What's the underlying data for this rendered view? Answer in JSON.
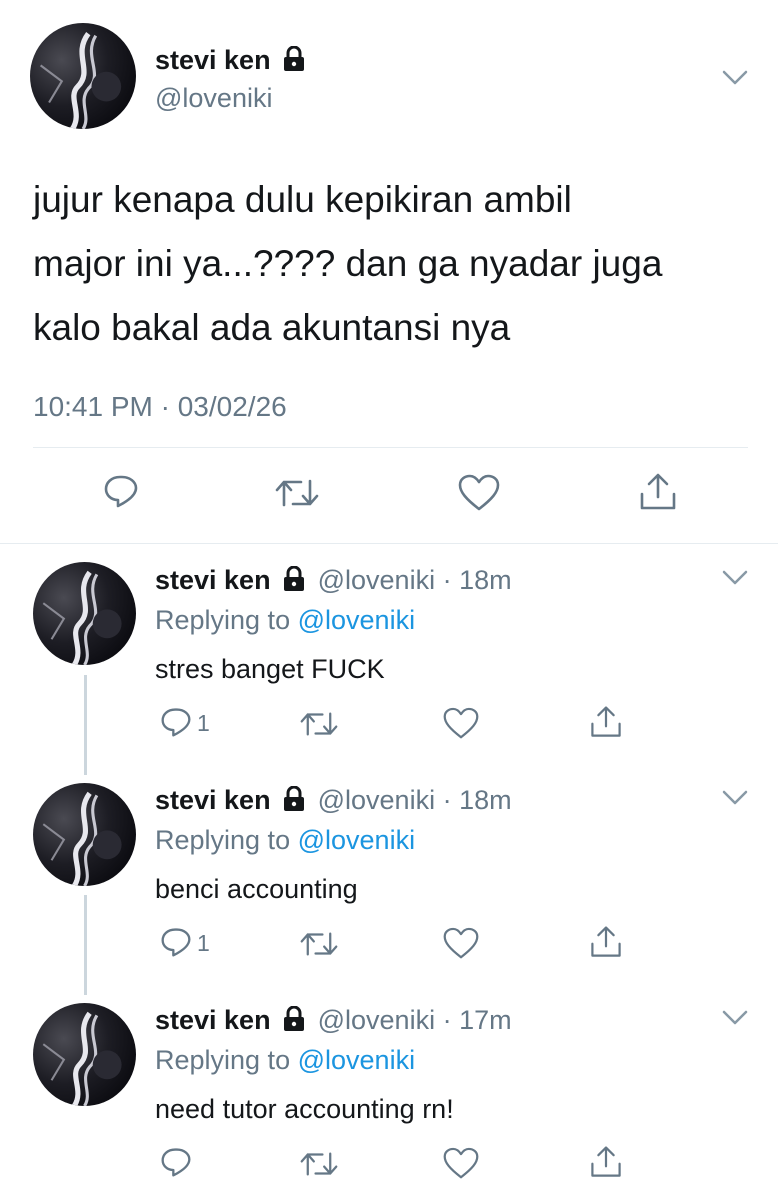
{
  "main_tweet": {
    "display_name": "stevi ken",
    "handle": "@loveniki",
    "text_lines": [
      "jujur kenapa dulu kepikiran ambil",
      "major ini ya...???? dan ga nyadar juga",
      "kalo bakal ada akuntansi nya"
    ],
    "timestamp": "10:41 PM · 03/02/26"
  },
  "replies": [
    {
      "display_name": "stevi ken",
      "handle": "@loveniki",
      "time": "· 18m",
      "replying_label": "Replying to",
      "replying_handle": "@loveniki",
      "text": "stres banget FUCK",
      "reply_count": "1"
    },
    {
      "display_name": "stevi ken",
      "handle": "@loveniki",
      "time": "· 18m",
      "replying_label": "Replying to",
      "replying_handle": "@loveniki",
      "text": "benci accounting",
      "reply_count": "1"
    },
    {
      "display_name": "stevi ken",
      "handle": "@loveniki",
      "time": "· 17m",
      "replying_label": "Replying to",
      "replying_handle": "@loveniki",
      "text": "need tutor accounting rn!",
      "reply_count": ""
    }
  ],
  "icons": {
    "lock": "lock-icon",
    "chevron": "chevron-down-icon",
    "reply": "reply-icon",
    "retweet": "retweet-icon",
    "like": "heart-icon",
    "share": "share-icon"
  },
  "colors": {
    "text": "#14171a",
    "secondary": "#657786",
    "link": "#1b95e0",
    "divider": "#e6ecf0"
  }
}
